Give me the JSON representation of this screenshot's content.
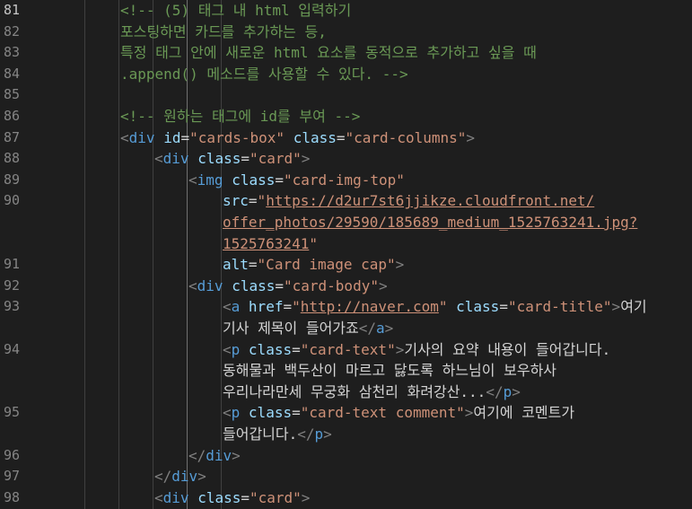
{
  "editor": {
    "lines": [
      {
        "n": "81",
        "indent": 2,
        "toks": [
          [
            "cm",
            "<!-- (5) 태그 내 html 입력하기"
          ]
        ]
      },
      {
        "n": "82",
        "indent": 2,
        "toks": [
          [
            "cm",
            "포스팅하면 카드를 추가하는 등,"
          ]
        ]
      },
      {
        "n": "83",
        "indent": 2,
        "toks": [
          [
            "cm",
            "특정 태그 안에 새로운 html 요소를 동적으로 추가하고 싶을 때"
          ]
        ]
      },
      {
        "n": "84",
        "indent": 2,
        "toks": [
          [
            "cm",
            ".append() 메소드를 사용할 수 있다. -->"
          ]
        ]
      },
      {
        "n": "85",
        "indent": 2,
        "toks": []
      },
      {
        "n": "86",
        "indent": 2,
        "toks": [
          [
            "cm",
            "<!-- 원하는 태그에 id를 부여 -->"
          ]
        ]
      },
      {
        "n": "87",
        "indent": 2,
        "toks": [
          [
            "br",
            "<"
          ],
          [
            "tag",
            "div"
          ],
          [
            "txt",
            " "
          ],
          [
            "attr",
            "id"
          ],
          [
            "eq",
            "="
          ],
          [
            "str",
            "\"cards-box\""
          ],
          [
            "txt",
            " "
          ],
          [
            "attr",
            "class"
          ],
          [
            "eq",
            "="
          ],
          [
            "str",
            "\"card-columns\""
          ],
          [
            "br",
            ">"
          ]
        ]
      },
      {
        "n": "88",
        "indent": 3,
        "toks": [
          [
            "br",
            "<"
          ],
          [
            "tag",
            "div"
          ],
          [
            "txt",
            " "
          ],
          [
            "attr",
            "class"
          ],
          [
            "eq",
            "="
          ],
          [
            "str",
            "\"card\""
          ],
          [
            "br",
            ">"
          ]
        ]
      },
      {
        "n": "89",
        "indent": 4,
        "toks": [
          [
            "br",
            "<"
          ],
          [
            "tag",
            "img"
          ],
          [
            "txt",
            " "
          ],
          [
            "attr",
            "class"
          ],
          [
            "eq",
            "="
          ],
          [
            "str",
            "\"card-img-top\""
          ]
        ]
      },
      {
        "n": "90",
        "indent": 5,
        "toks": [
          [
            "attr",
            "src"
          ],
          [
            "eq",
            "="
          ],
          [
            "str",
            "\""
          ],
          [
            "url",
            "https://d2ur7st6jjikze.cloudfront.net/"
          ]
        ]
      },
      {
        "n": "",
        "indent": 5,
        "toks": [
          [
            "url",
            "offer_photos/29590/185689_medium_1525763241.jpg?"
          ]
        ]
      },
      {
        "n": "",
        "indent": 5,
        "toks": [
          [
            "url",
            "1525763241"
          ],
          [
            "str",
            "\""
          ]
        ]
      },
      {
        "n": "91",
        "indent": 5,
        "toks": [
          [
            "attr",
            "alt"
          ],
          [
            "eq",
            "="
          ],
          [
            "str",
            "\"Card image cap\""
          ],
          [
            "br",
            ">"
          ]
        ]
      },
      {
        "n": "92",
        "indent": 4,
        "toks": [
          [
            "br",
            "<"
          ],
          [
            "tag",
            "div"
          ],
          [
            "txt",
            " "
          ],
          [
            "attr",
            "class"
          ],
          [
            "eq",
            "="
          ],
          [
            "str",
            "\"card-body\""
          ],
          [
            "br",
            ">"
          ]
        ]
      },
      {
        "n": "93",
        "indent": 5,
        "toks": [
          [
            "br",
            "<"
          ],
          [
            "tag",
            "a"
          ],
          [
            "txt",
            " "
          ],
          [
            "attr",
            "href"
          ],
          [
            "eq",
            "="
          ],
          [
            "str",
            "\""
          ],
          [
            "url",
            "http://naver.com"
          ],
          [
            "str",
            "\""
          ],
          [
            "txt",
            " "
          ],
          [
            "attr",
            "class"
          ],
          [
            "eq",
            "="
          ],
          [
            "str",
            "\"card-title\""
          ],
          [
            "br",
            ">"
          ],
          [
            "txt",
            "여기"
          ]
        ]
      },
      {
        "n": "",
        "indent": 5,
        "toks": [
          [
            "txt",
            "기사 제목이 들어가죠"
          ],
          [
            "br",
            "</"
          ],
          [
            "tag",
            "a"
          ],
          [
            "br",
            ">"
          ]
        ]
      },
      {
        "n": "94",
        "indent": 5,
        "toks": [
          [
            "br",
            "<"
          ],
          [
            "tag",
            "p"
          ],
          [
            "txt",
            " "
          ],
          [
            "attr",
            "class"
          ],
          [
            "eq",
            "="
          ],
          [
            "str",
            "\"card-text\""
          ],
          [
            "br",
            ">"
          ],
          [
            "txt",
            "기사의 요약 내용이 들어갑니다."
          ]
        ]
      },
      {
        "n": "",
        "indent": 5,
        "toks": [
          [
            "txt",
            "동해물과 백두산이 마르고 닳도록 하느님이 보우하사"
          ]
        ]
      },
      {
        "n": "",
        "indent": 5,
        "toks": [
          [
            "txt",
            "우리나라만세 무궁화 삼천리 화려강산..."
          ],
          [
            "br",
            "</"
          ],
          [
            "tag",
            "p"
          ],
          [
            "br",
            ">"
          ]
        ]
      },
      {
        "n": "95",
        "indent": 5,
        "toks": [
          [
            "br",
            "<"
          ],
          [
            "tag",
            "p"
          ],
          [
            "txt",
            " "
          ],
          [
            "attr",
            "class"
          ],
          [
            "eq",
            "="
          ],
          [
            "str",
            "\"card-text comment\""
          ],
          [
            "br",
            ">"
          ],
          [
            "txt",
            "여기에 코멘트가"
          ]
        ]
      },
      {
        "n": "",
        "indent": 5,
        "toks": [
          [
            "txt",
            "들어갑니다."
          ],
          [
            "br",
            "</"
          ],
          [
            "tag",
            "p"
          ],
          [
            "br",
            ">"
          ]
        ]
      },
      {
        "n": "96",
        "indent": 4,
        "toks": [
          [
            "br",
            "</"
          ],
          [
            "tag",
            "div"
          ],
          [
            "br",
            ">"
          ]
        ]
      },
      {
        "n": "97",
        "indent": 3,
        "toks": [
          [
            "br",
            "</"
          ],
          [
            "tag",
            "div"
          ],
          [
            "br",
            ">"
          ]
        ]
      },
      {
        "n": "98",
        "indent": 3,
        "toks": [
          [
            "br",
            "<"
          ],
          [
            "tag",
            "div"
          ],
          [
            "txt",
            " "
          ],
          [
            "attr",
            "class"
          ],
          [
            "eq",
            "="
          ],
          [
            "str",
            "\"card\""
          ],
          [
            "br",
            ">"
          ]
        ]
      }
    ],
    "active_line": "81",
    "colors": {
      "background": "#1e1e1e",
      "comment": "#6a9955",
      "tag": "#569cd6",
      "attribute": "#9cdcfe",
      "string": "#ce9178",
      "text": "#d4d4d4",
      "line_number": "#858585"
    }
  }
}
